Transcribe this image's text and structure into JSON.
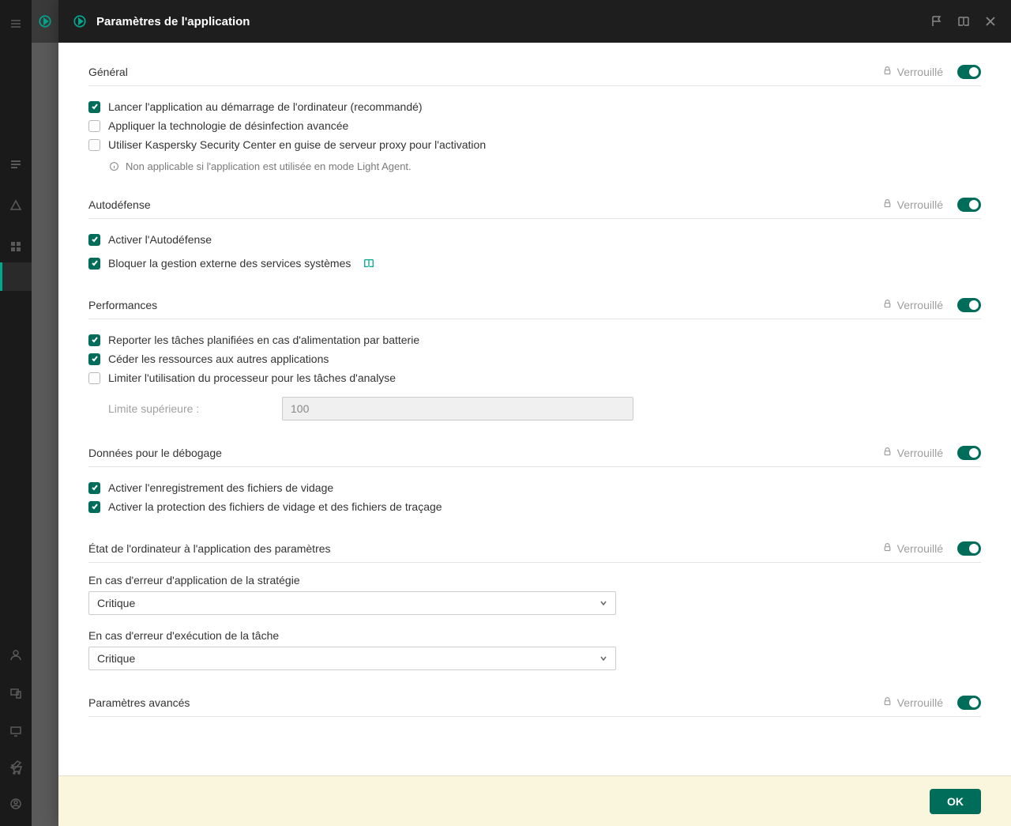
{
  "header": {
    "title": "Paramètres de l'application"
  },
  "locked_label": "Verrouillé",
  "sections": {
    "general": {
      "title": "Général",
      "chk_start": "Lancer l'application au démarrage de l'ordinateur (recommandé)",
      "chk_disinfect": "Appliquer la technologie de désinfection avancée",
      "chk_proxy": "Utiliser Kaspersky Security Center en guise de serveur proxy pour l'activation",
      "note": "Non applicable si l'application est utilisée en mode Light Agent."
    },
    "autodef": {
      "title": "Autodéfense",
      "chk_enable": "Activer l'Autodéfense",
      "chk_block": "Bloquer la gestion externe des services systèmes"
    },
    "perf": {
      "title": "Performances",
      "chk_battery": "Reporter les tâches planifiées en cas d'alimentation par batterie",
      "chk_yield": "Céder les ressources aux autres applications",
      "chk_limitcpu": "Limiter l'utilisation du processeur pour les tâches d'analyse",
      "limit_label": "Limite supérieure :",
      "limit_value": "100"
    },
    "debug": {
      "title": "Données pour le débogage",
      "chk_dump": "Activer l'enregistrement des fichiers de vidage",
      "chk_protect": "Activer la protection des fichiers de vidage et des fichiers de traçage"
    },
    "state": {
      "title": "État de l'ordinateur à l'application des paramètres",
      "label_policy": "En cas d'erreur d'application de la stratégie",
      "value_policy": "Critique",
      "label_task": "En cas d'erreur d'exécution de la tâche",
      "value_task": "Critique"
    },
    "advanced": {
      "title": "Paramètres avancés"
    }
  },
  "footer": {
    "ok": "OK"
  }
}
